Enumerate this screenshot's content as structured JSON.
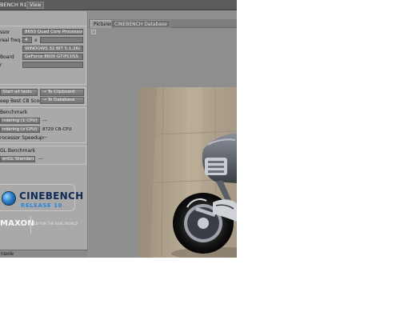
{
  "titlebar": {
    "title": "BENCH R10",
    "menu_view": "View"
  },
  "system": {
    "processor_label": "ssor",
    "processor_value": "8650 Quad Core Processor",
    "cores_label": "real freq.)",
    "cores_value": "4",
    "cores_sep": "x",
    "os_value": "WINDOWS 32 BIT 5.1.26(",
    "board_label": "Board",
    "board_value": "GeForce 8600 GT/PCI/SS",
    "r_label": "r"
  },
  "actions": {
    "start_all": "Start all tests",
    "to_clipboard": "To Clipboard",
    "keep_best": "eep Best CB Score",
    "to_database": "To Database",
    "arrow": "→"
  },
  "cpu_benchmark": {
    "title": "Benchmark",
    "single_label": "ndering (1 CPU)",
    "single_value": "---",
    "multi_label": "ndering (x CPU)",
    "multi_value": "8729 CB-CPU",
    "speedup_label": "rocessor Speedup:",
    "speedup_value": "---"
  },
  "gl_benchmark": {
    "title": "GL Benchmark",
    "standard_label": "enGL Standard",
    "standard_value": "---"
  },
  "logo": {
    "name": "CINEBENCH",
    "release": "RELEASE 10",
    "maxon": "MAXON",
    "tagline": "3D FOR THE REAL WORLD"
  },
  "console": {
    "label": "nsole"
  },
  "tabs": {
    "pictures": "Pictures",
    "database": "CINEBENCH Database"
  },
  "colors": {
    "app_bg": "#979797",
    "panel_bg": "#a9a9a9",
    "titlebar_bg": "#5b5b5b",
    "logo_blue": "#2c87d6"
  }
}
